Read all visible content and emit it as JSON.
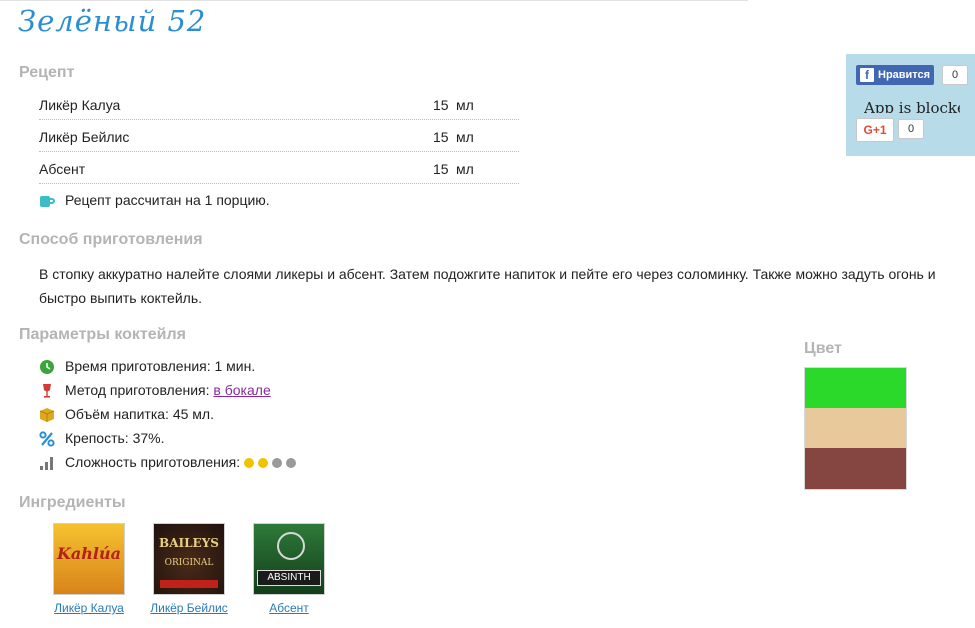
{
  "title": "Зелёный 52",
  "recipe": {
    "heading": "Рецепт",
    "items": [
      {
        "name": "Ликёр Калуа",
        "amount": "15",
        "unit": "мл"
      },
      {
        "name": "Ликёр Бейлис",
        "amount": "15",
        "unit": "мл"
      },
      {
        "name": "Абсент",
        "amount": "15",
        "unit": "мл"
      }
    ],
    "portion_note": "Рецепт рассчитан на 1 порцию."
  },
  "preparation": {
    "heading": "Способ приготовления",
    "text": "В стопку аккуратно налейте слоями ликеры и абсент. Затем подожгите напиток и пейте его через соломинку. Также можно задуть огонь и быстро выпить коктейль."
  },
  "params": {
    "heading": "Параметры коктейля",
    "time": "Время приготовления: 1 мин.",
    "method_label": "Метод приготовления: ",
    "method_link": "в бокале",
    "volume": "Объём напитка: 45 мл.",
    "strength": "Крепость: 37%.",
    "difficulty_label": "Сложность приготовления:",
    "difficulty": {
      "level": 2,
      "max": 4,
      "active_color": "#f2c200",
      "inactive_color": "#9a9a9a"
    }
  },
  "color": {
    "heading": "Цвет",
    "swatches": [
      "#2ad92a",
      "#e8c99b",
      "#854540"
    ]
  },
  "ingredients": {
    "heading": "Ингредиенты",
    "items": [
      {
        "name": "Ликёр Калуа",
        "thumb_text": "Kahlúa"
      },
      {
        "name": "Ликёр Бейлис",
        "thumb_text": "BAILEYS",
        "thumb_sub": "ORIGINAL"
      },
      {
        "name": "Абсент",
        "thumb_text": "ABSINTH"
      }
    ]
  },
  "social": {
    "fb_label": "Нравится",
    "fb_count": "0",
    "blocked_text": "App is blocked",
    "gplus_label": "G+1",
    "gplus_count": "0"
  },
  "icons": {
    "portion": "mug-icon",
    "time": "clock-icon",
    "method": "wine-glass-icon",
    "volume": "box-icon",
    "strength": "percent-icon",
    "difficulty": "bars-icon"
  }
}
